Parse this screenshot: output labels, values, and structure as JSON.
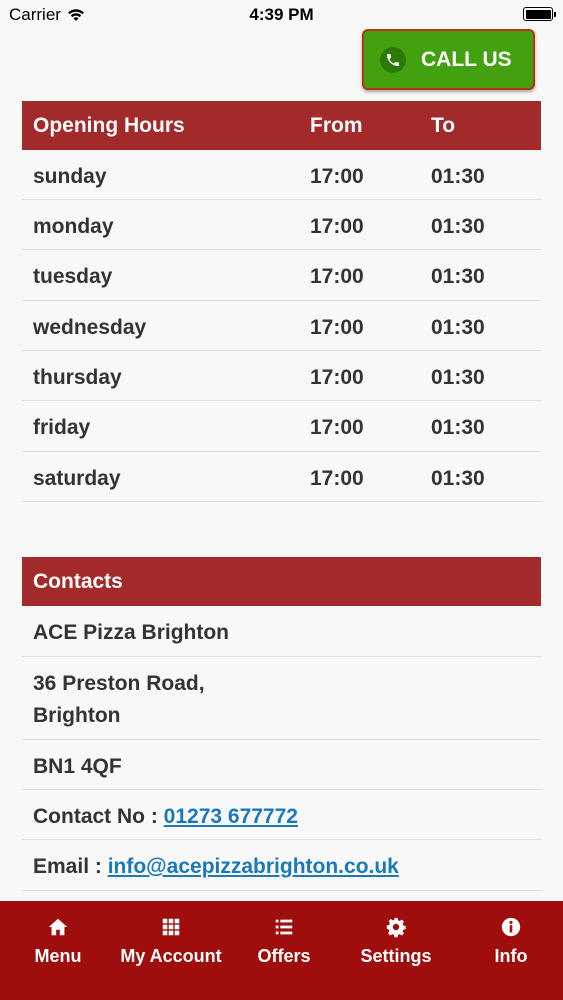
{
  "status_bar": {
    "carrier": "Carrier",
    "time": "4:39 PM"
  },
  "call_button": {
    "label": "CALL US",
    "icon": "phone-icon",
    "color": "#43a00f"
  },
  "opening_hours": {
    "header": {
      "title": "Opening Hours",
      "from": "From",
      "to": "To"
    },
    "rows": [
      {
        "day": "sunday",
        "from": "17:00",
        "to": "01:30"
      },
      {
        "day": "monday",
        "from": "17:00",
        "to": "01:30"
      },
      {
        "day": "tuesday",
        "from": "17:00",
        "to": "01:30"
      },
      {
        "day": "wednesday",
        "from": "17:00",
        "to": "01:30"
      },
      {
        "day": "thursday",
        "from": "17:00",
        "to": "01:30"
      },
      {
        "day": "friday",
        "from": "17:00",
        "to": "01:30"
      },
      {
        "day": "saturday",
        "from": "17:00",
        "to": "01:30"
      }
    ]
  },
  "contacts": {
    "title": "Contacts",
    "name": "ACE Pizza Brighton",
    "address_line1": "36 Preston Road,",
    "address_line2": "Brighton",
    "postcode": "BN1 4QF",
    "phone_label": "Contact No : ",
    "phone": "01273 677772",
    "email_label": "Email : ",
    "email": "info@acepizzabrighton.co.uk"
  },
  "tab_bar": {
    "color": "#a00d0d",
    "items": [
      {
        "label": "Menu",
        "icon": "home-icon"
      },
      {
        "label": "My Account",
        "icon": "grid-icon"
      },
      {
        "label": "Offers",
        "icon": "list-icon"
      },
      {
        "label": "Settings",
        "icon": "gear-icon"
      },
      {
        "label": "Info",
        "icon": "info-icon"
      }
    ]
  },
  "colors": {
    "header_red": "#a32a2a",
    "link_blue": "#1a7ab8"
  }
}
